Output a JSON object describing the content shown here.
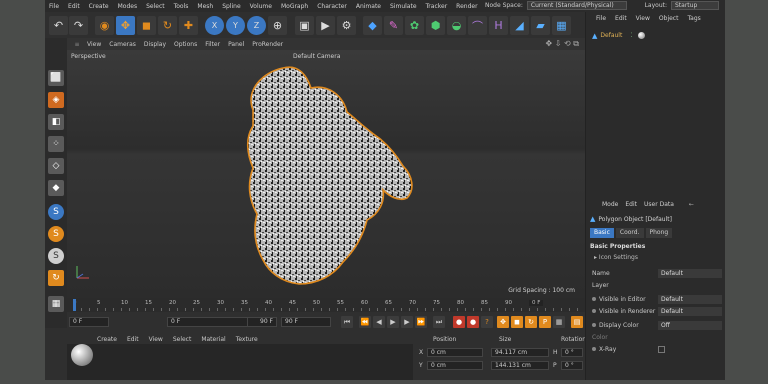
{
  "menubar": {
    "items": [
      "File",
      "Edit",
      "Create",
      "Modes",
      "Select",
      "Tools",
      "Mesh",
      "Spline",
      "Volume",
      "MoGraph",
      "Character",
      "Animate",
      "Simulate",
      "Tracker",
      "Render"
    ],
    "node_space_label": "Node Space:",
    "node_space_value": "Current (Standard/Physical)",
    "layout_label": "Layout:",
    "layout_value": "Startup"
  },
  "toolbar": {
    "axis_x": "X",
    "axis_y": "Y",
    "axis_z": "Z"
  },
  "viewport": {
    "menu": [
      "View",
      "Cameras",
      "Display",
      "Options",
      "Filter",
      "Panel",
      "ProRender"
    ],
    "label_perspective": "Perspective",
    "label_camera": "Default Camera",
    "grid_spacing": "Grid Spacing : 100 cm"
  },
  "timeline": {
    "ticks": [
      "0",
      "5",
      "10",
      "15",
      "20",
      "25",
      "30",
      "35",
      "40",
      "45",
      "50",
      "55",
      "60",
      "65",
      "70",
      "75",
      "80",
      "85",
      "90"
    ],
    "end_frame_label": "0 F",
    "current_frame": "0 F",
    "min_frame": "0 F",
    "max_frame": "90 F",
    "end_frame": "90 F"
  },
  "material_manager": {
    "menu": [
      "Create",
      "Edit",
      "View",
      "Select",
      "Material",
      "Texture"
    ]
  },
  "coordinates": {
    "headers": [
      "Position",
      "Size",
      "Rotation"
    ],
    "rows": [
      {
        "axis": "X",
        "position": "0 cm",
        "size": "94.117 cm",
        "rot_axis": "H",
        "rotation": "0 °"
      },
      {
        "axis": "Y",
        "position": "0 cm",
        "size": "144.131 cm",
        "rot_axis": "P",
        "rotation": "0 °"
      }
    ]
  },
  "object_manager": {
    "menu": [
      "File",
      "Edit",
      "View",
      "Object",
      "Tags"
    ],
    "object_name": "Default"
  },
  "attributes": {
    "menu": [
      "Mode",
      "Edit",
      "User Data"
    ],
    "title": "Polygon Object [Default]",
    "tabs": [
      "Basic",
      "Coord.",
      "Phong"
    ],
    "section": "Basic Properties",
    "subsection": "Icon Settings",
    "props": [
      {
        "label": "Name",
        "value": "Default"
      },
      {
        "label": "Layer",
        "value": ""
      },
      {
        "label": "Visible in Editor",
        "value": "Default"
      },
      {
        "label": "Visible in Renderer",
        "value": "Default"
      },
      {
        "label": "Display Color",
        "value": "Off"
      },
      {
        "label": "Color",
        "value": ""
      },
      {
        "label": "X-Ray",
        "value": ""
      }
    ]
  },
  "colors": {
    "accent_blue": "#3b78c3",
    "object_orange": "#e2b356",
    "record_red": "#c0392b"
  }
}
